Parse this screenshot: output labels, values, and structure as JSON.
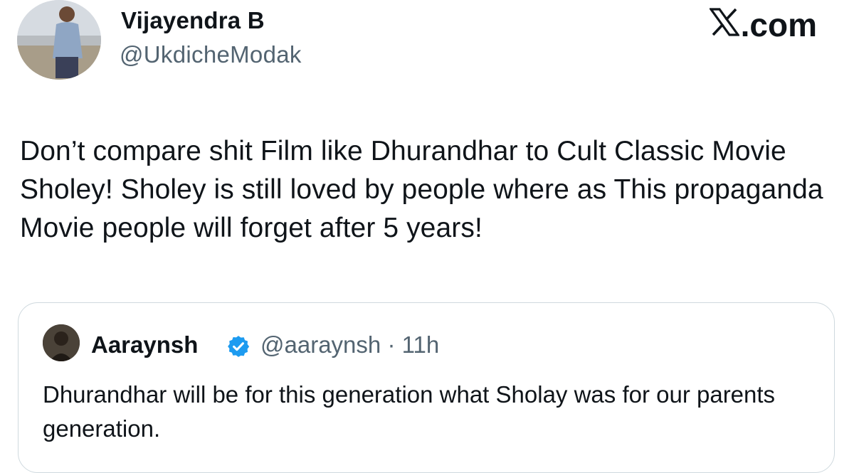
{
  "tweet": {
    "author": {
      "name": "Vijayendra B",
      "handle": "@UkdicheModak",
      "avatar": "avatar-photo"
    },
    "brand": {
      "icon": "x-logo-icon",
      "text": ".com"
    },
    "text": "Don’t compare shit Film like Dhurandhar to Cult Classic Movie Sholey! Sholey is still loved by people where as This propaganda Movie people will forget after 5 years!"
  },
  "quoted": {
    "author": {
      "name": "Aaraynsh",
      "handle": "@aaraynsh",
      "verified_icon": "verified-badge-icon",
      "avatar": "avatar-photo"
    },
    "separator": "·",
    "time": "11h",
    "text": "Dhurandhar will be for this generation what Sholay was for our parents generation."
  },
  "colors": {
    "text": "#0f1419",
    "secondary": "#536471",
    "verified": "#1d9bf0",
    "border": "#cfd9de"
  }
}
